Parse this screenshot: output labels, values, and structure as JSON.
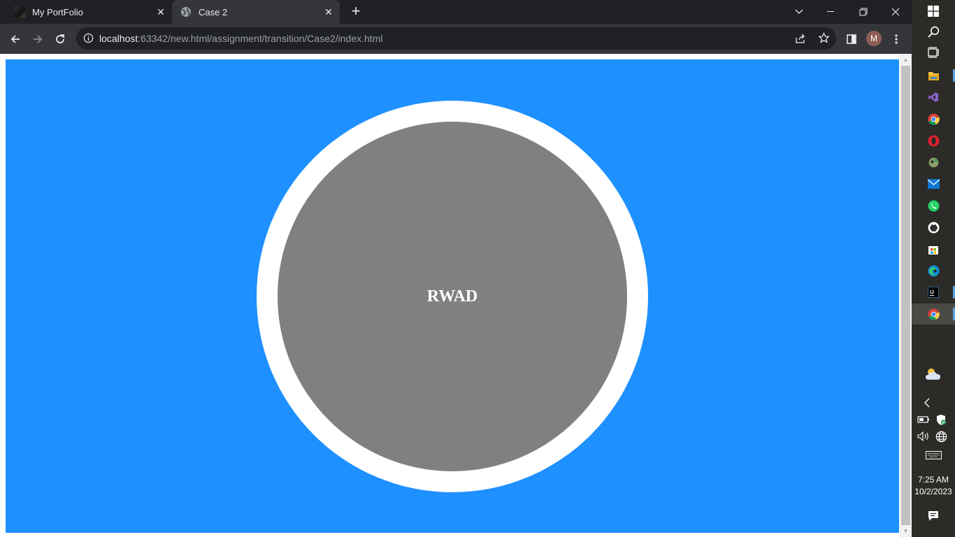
{
  "tabs": [
    {
      "title": "My PortFolio",
      "active": false,
      "favicon": "portfolio-favicon"
    },
    {
      "title": "Case 2",
      "active": true,
      "favicon": "globe-icon"
    }
  ],
  "toolbar": {
    "url_host": "localhost",
    "url_rest": ":63342/new.html/assignment/transition/Case2/index.html",
    "profile_initial": "M"
  },
  "page": {
    "circle_label": "RWAD",
    "background_color": "#1e90ff",
    "ring_color": "#ffffff",
    "arc_color": "#ff0000",
    "circle_color": "#808080"
  },
  "taskbar": {
    "time": "7:25 AM",
    "date": "10/2/2023",
    "apps": [
      "windows-start-icon",
      "search-icon",
      "task-view-icon",
      "file-explorer-icon",
      "visual-studio-icon",
      "chrome-icon",
      "opera-icon",
      "spotify-like-icon",
      "mail-icon",
      "whatsapp-icon",
      "github-icon",
      "microsoft-store-icon",
      "edge-icon",
      "intellij-icon",
      "chrome-active-icon"
    ]
  }
}
